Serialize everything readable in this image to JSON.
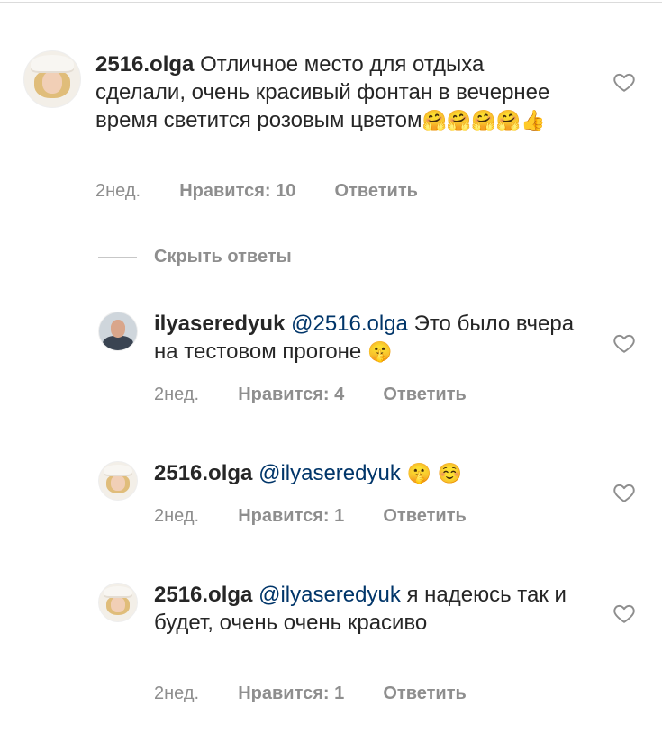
{
  "comments": [
    {
      "user": "2516.olga",
      "mention": "",
      "text": "Отличное место для отдыха сделали, очень красивый фонтан в вечернее время светится розовым цветом",
      "emoji": "🤗🤗🤗🤗👍",
      "time": "2нед.",
      "likes": "Нравится: 10",
      "reply": "Ответить"
    },
    {
      "user": "ilyaseredyuk",
      "mention": "@2516.olga",
      "text": "Это было вчера на тестовом прогоне",
      "emoji": "🤫",
      "time": "2нед.",
      "likes": "Нравится: 4",
      "reply": "Ответить"
    },
    {
      "user": "2516.olga",
      "mention": "@ilyaseredyuk",
      "text": "",
      "emoji": "🤫 ☺️",
      "time": "2нед.",
      "likes": "Нравится: 1",
      "reply": "Ответить"
    },
    {
      "user": "2516.olga",
      "mention": "@ilyaseredyuk",
      "text": "я надеюсь так и будет, очень очень красиво",
      "emoji": "",
      "time": "2нед.",
      "likes": "Нравится: 1",
      "reply": "Ответить"
    }
  ],
  "hide_replies_label": "Скрыть ответы",
  "icons": {
    "like": "heart-outline-icon"
  },
  "colors": {
    "text": "#262626",
    "secondary": "#8e8e8e",
    "mention": "#003569"
  }
}
